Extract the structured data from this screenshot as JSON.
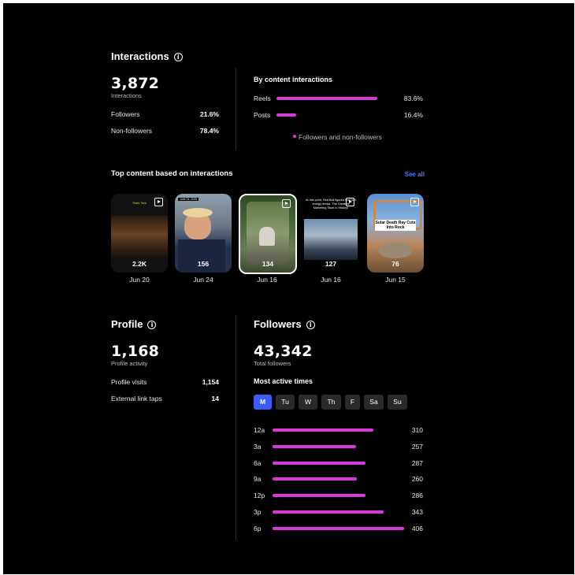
{
  "colors": {
    "background": "#000000",
    "accent_bar": "#d43bd8",
    "active_day": "#3d5bf5",
    "link": "#4a78ff"
  },
  "interactions": {
    "title": "Interactions",
    "total": "3,872",
    "total_label": "Interactions",
    "rows": [
      {
        "label": "Followers",
        "value": "21.6%"
      },
      {
        "label": "Non-followers",
        "value": "78.4%"
      }
    ]
  },
  "by_content": {
    "title": "By content interactions",
    "rows": [
      {
        "label": "Reels",
        "value": "83.6%",
        "fraction": 0.836
      },
      {
        "label": "Posts",
        "value": "16.4%",
        "fraction": 0.164
      }
    ],
    "legend": "Followers and non-followers"
  },
  "top_content": {
    "title": "Top content based on interactions",
    "see_all": "See all",
    "items": [
      {
        "count": "2.2K",
        "date": "Jun 20",
        "caption": "Shark Tank"
      },
      {
        "count": "156",
        "date": "Jun 24",
        "caption": "June 24, 2025"
      },
      {
        "count": "134",
        "date": "Jun 16",
        "caption": ""
      },
      {
        "count": "127",
        "date": "Jun 16",
        "caption": "At this point, Red Bull figured they sell energy drinks. The Greatest Marketing Stunt in History!"
      },
      {
        "count": "76",
        "date": "Jun 15",
        "caption": "Solar Death Ray Cuts Into Rock"
      }
    ]
  },
  "profile": {
    "title": "Profile",
    "total": "1,168",
    "total_label": "Profile activity",
    "rows": [
      {
        "label": "Profile visits",
        "value": "1,154"
      },
      {
        "label": "External link taps",
        "value": "14"
      }
    ]
  },
  "followers": {
    "title": "Followers",
    "total": "43,342",
    "total_label": "Total followers",
    "most_active_title": "Most active times",
    "days": [
      "M",
      "Tu",
      "W",
      "Th",
      "F",
      "Sa",
      "Su"
    ],
    "selected_day": "M",
    "times": [
      {
        "label": "12a",
        "value": 310
      },
      {
        "label": "3a",
        "value": 257
      },
      {
        "label": "6a",
        "value": 287
      },
      {
        "label": "9a",
        "value": 260
      },
      {
        "label": "12p",
        "value": 286
      },
      {
        "label": "3p",
        "value": 343
      },
      {
        "label": "6p",
        "value": 406
      }
    ]
  }
}
